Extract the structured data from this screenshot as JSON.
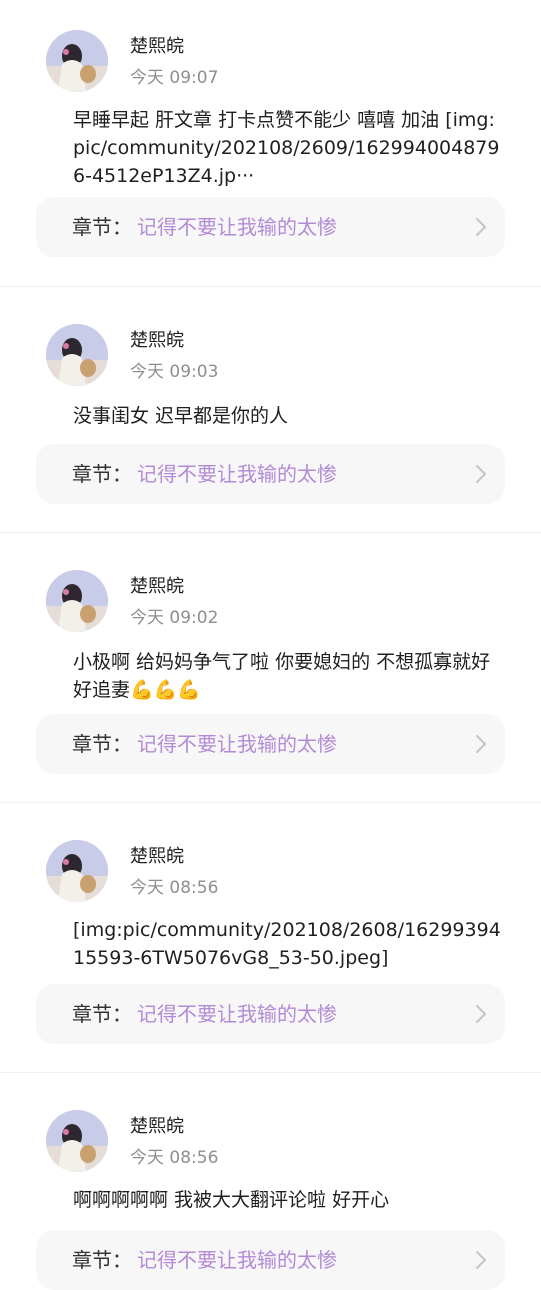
{
  "posts": [
    {
      "username": "楚熙皖",
      "time": "今天 09:07",
      "content": "早睡早起 肝文章 打卡点赞不能少 嘻嘻 加油 [img:pic/community/202108/2609/1629940048796-4512eP13Z4.jp···",
      "chapter_label": "章节：",
      "chapter_title": "记得不要让我输的太惨"
    },
    {
      "username": "楚熙皖",
      "time": "今天 09:03",
      "content": "没事闺女 迟早都是你的人",
      "chapter_label": "章节：",
      "chapter_title": "记得不要让我输的太惨"
    },
    {
      "username": "楚熙皖",
      "time": "今天 09:02",
      "content": "小极啊 给妈妈争气了啦 你要媳妇的 不想孤寡就好好追妻💪💪💪",
      "chapter_label": "章节：",
      "chapter_title": "记得不要让我输的太惨"
    },
    {
      "username": "楚熙皖",
      "time": "今天 08:56",
      "content": "[img:pic/community/202108/2608/1629939415593-6TW5076vG8_53-50.jpeg]",
      "chapter_label": "章节：",
      "chapter_title": "记得不要让我输的太惨"
    },
    {
      "username": "楚熙皖",
      "time": "今天 08:56",
      "content": "啊啊啊啊啊 我被大大翻评论啦 好开心",
      "chapter_label": "章节：",
      "chapter_title": "记得不要让我输的太惨"
    }
  ],
  "icons": {
    "avatar": "avatar",
    "chevron": "chevron-right-icon"
  },
  "colors": {
    "chapter_title": "#b38ad6",
    "chapter_bg": "#f7f7f8",
    "time": "#8e8e93"
  }
}
